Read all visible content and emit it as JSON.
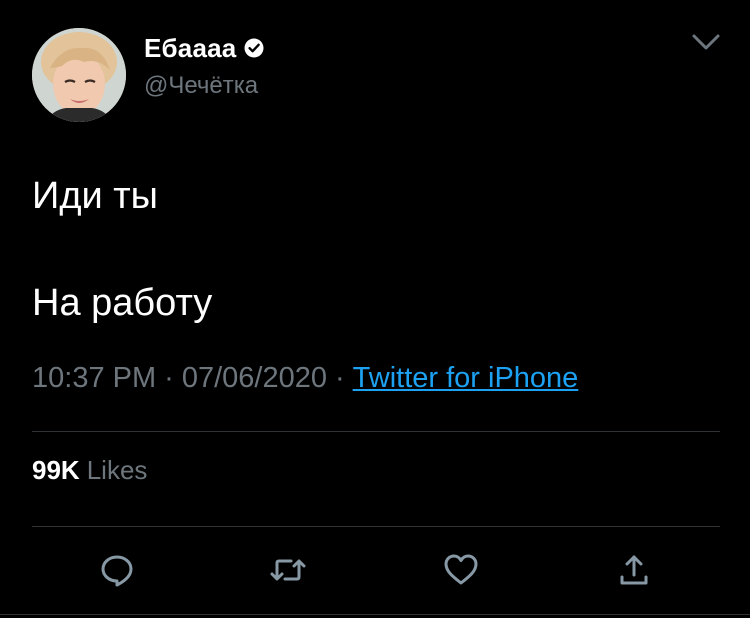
{
  "user": {
    "display_name": "Ебаааа",
    "handle": "@Чечётка",
    "verified": true
  },
  "tweet": {
    "lines": [
      "Иди ты",
      "На работу"
    ],
    "time": "10:37 PM",
    "date": "07/06/2020",
    "separator": "·",
    "source": "Twitter for iPhone"
  },
  "stats": {
    "likes_count": "99K",
    "likes_label": "Likes"
  },
  "icons": {
    "menu": "chevron-down-icon",
    "verified": "verified-badge-icon",
    "reply": "reply-icon",
    "retweet": "retweet-icon",
    "like": "heart-icon",
    "share": "share-icon"
  },
  "colors": {
    "background": "#000000",
    "text": "#ffffff",
    "secondary": "#6e767d",
    "link": "#1da1f2",
    "divider": "#2f3336"
  }
}
